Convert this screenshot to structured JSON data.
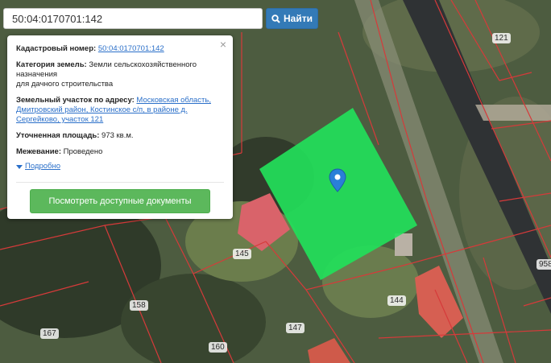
{
  "search": {
    "value": "50:04:0170701:142",
    "button_label": "Найти"
  },
  "popup": {
    "cadastral_label": "Кадастровый номер:",
    "cadastral_value": "50:04:0170701:142",
    "category_label": "Категория земель:",
    "category_value": "Земли сельскохозяйственного назначения",
    "category_value_2": "для дачного строительства",
    "address_label": "Земельный участок по адресу:",
    "address_value": "Московская область, Дмитровский район, Костинское с/п, в районе д. Сергейково, участок 121",
    "area_label": "Уточненная площадь:",
    "area_value": "973 кв.м.",
    "survey_label": "Межевание:",
    "survey_value": "Проведено",
    "details_link": "Подробно",
    "docs_button": "Посмотреть доступные документы",
    "close_glyph": "×"
  },
  "map": {
    "plot_labels": [
      "121",
      "145",
      "144",
      "158",
      "167",
      "147",
      "160",
      "958"
    ],
    "highlight_color": "#22e05a",
    "marker_color": "#2a7fd8",
    "boundary_color": "#d63a3a"
  }
}
